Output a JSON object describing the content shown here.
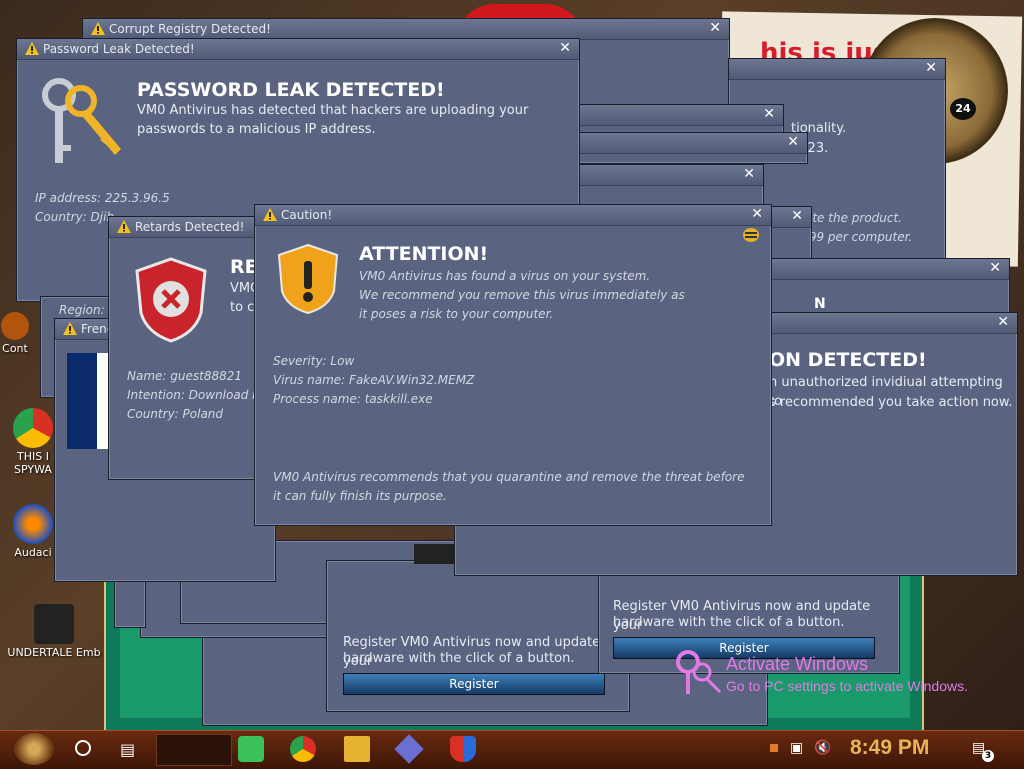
{
  "wallpaper": {
    "note_text": "his is jus",
    "clock_number": "24"
  },
  "desktop_icons": [
    {
      "label": "Cont",
      "color": "#b0540e"
    },
    {
      "label": "THIS I",
      "label2": "SPYWA",
      "color": "#2aa14b"
    },
    {
      "label": "Audaci",
      "color": "#1e4fbf"
    },
    {
      "label": "UNDERTALE",
      "label2": "Emb",
      "color": "#222222"
    }
  ],
  "windows": {
    "corrupt_registry": {
      "title": "Corrupt Registry Detected!"
    },
    "password_leak": {
      "title": "Password Leak Detected!",
      "heading": "PASSWORD LEAK DETECTED!",
      "body": "VM0 Antivirus has detected that hackers are uploading your passwords to a malicious IP address.",
      "ip": "IP address: 225.3.96.5",
      "country": "Country: Djib",
      "region": "Region:"
    },
    "back_right": {
      "line1": "tionality.",
      "line2": "2023.",
      "line3": "ate the product.",
      "line4": ".99 per computer."
    },
    "retards": {
      "title": "Retards Detected!",
      "heading": "RE",
      "line1": "VMC",
      "line2": "to c",
      "name": "Name: guest88821",
      "intention": "Intention: Download M",
      "country": "Country: Poland"
    },
    "french": {
      "title": "Frenc"
    },
    "caution": {
      "title": "Caution!",
      "heading": "ATTENTION!",
      "body1": "VM0 Antivirus has found a virus on your system.",
      "body2": "We recommend you remove this virus immediately as",
      "body3": "it poses a risk to your computer.",
      "severity": "Severity: Low",
      "virus": "Virus name: FakeAV.Win32.MEMZ",
      "process": "Process name: taskkill.exe",
      "footer1": "VM0 Antivirus recommends that you quarantine and remove the threat before",
      "footer2": "it can fully finish its purpose."
    },
    "intrusion": {
      "heading": "ON DETECTED!",
      "line1": "n unauthorized invidiual attempting to",
      "line2": "s recommended you take action now.",
      "small": "N"
    },
    "register_bottom": {
      "text1": "Register VM0 Antivirus now and update your",
      "text2": "hardware with the click of a button.",
      "button": "Register"
    },
    "register_right": {
      "text1": "Register VM0 Antivirus now and update your",
      "text2": "hardware with the click of a button.",
      "button": "Register"
    }
  },
  "watermark": {
    "title": "Activate Windows",
    "subtitle": "Go to PC settings to activate Windows."
  },
  "taskbar": {
    "time": "8:49 PM",
    "notification_count": "3"
  }
}
